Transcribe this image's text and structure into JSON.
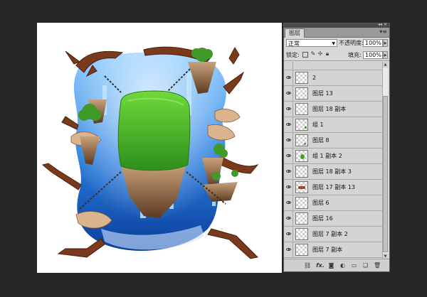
{
  "panel": {
    "title": "图层",
    "menu_icon": "panel-menu-icon",
    "collapse_icon": "double-arrow-icon",
    "blend_mode": "正常",
    "opacity_label": "不透明度:",
    "opacity_value": "100%",
    "lock_label": "锁定:",
    "fill_label": "填充:",
    "fill_value": "100%"
  },
  "layers": [
    {
      "name": "2",
      "thumb": "empty"
    },
    {
      "name": "图层 13",
      "thumb": "empty"
    },
    {
      "name": "图层 18 副本",
      "thumb": "empty"
    },
    {
      "name": "组 1",
      "thumb": "dot-green"
    },
    {
      "name": "图层 8",
      "thumb": "dot-gray"
    },
    {
      "name": "组 1 副本 2",
      "thumb": "tree"
    },
    {
      "name": "图层 18 副本 3",
      "thumb": "empty"
    },
    {
      "name": "图层 17 副本 13",
      "thumb": "brown"
    },
    {
      "name": "图层 6",
      "thumb": "empty"
    },
    {
      "name": "图层 16",
      "thumb": "empty"
    },
    {
      "name": "图层 7 副本 2",
      "thumb": "empty"
    },
    {
      "name": "图层 7 副本",
      "thumb": "empty"
    }
  ],
  "footer_icons": [
    "link-layers-icon",
    "fx-icon",
    "layer-mask-icon",
    "adjustment-layer-icon",
    "new-group-icon",
    "new-layer-icon",
    "trash-icon"
  ],
  "footer_fx_label": "fx."
}
